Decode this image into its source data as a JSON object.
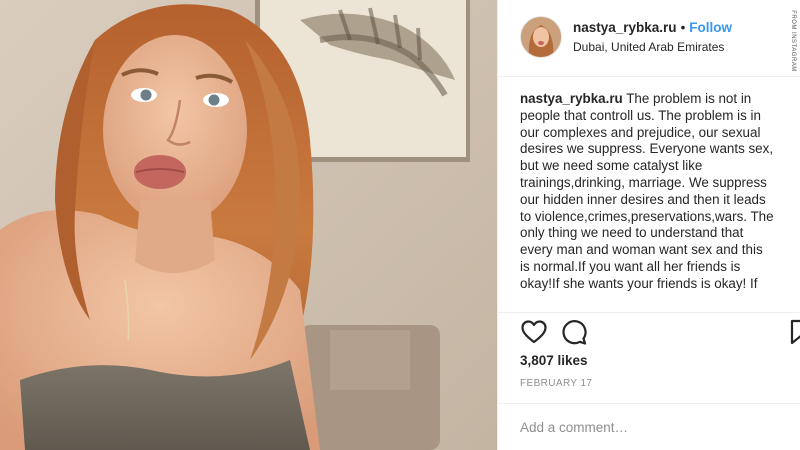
{
  "post": {
    "username": "nastya_rybka.ru",
    "separator": "•",
    "follow_label": "Follow",
    "location": "Dubai, United Arab Emirates",
    "credit": "FROM INSTAGRAM",
    "caption_user": "nastya_rybka.ru",
    "caption_text": "The problem is not in\npeople that controll us. The problem is in\nour complexes and prejudice, our sexual\ndesires we suppress. Everyone wants sex,\nbut we need some catalyst like\ntrainings,drinking, marriage. We suppress\nour hidden inner desires and then it leads\nto violence,crimes,preservations,wars. The\nonly thing we need to understand that\nevery man and woman want sex and this\nis normal.If you want all her friends is\nokay!If she wants your friends is okay! If",
    "likes": "3,807 likes",
    "date": "FEBRUARY 17",
    "comment_placeholder": "Add a comment…"
  },
  "icons": {
    "like": "heart-icon",
    "comment": "comment-bubble-icon",
    "save": "bookmark-icon"
  },
  "colors": {
    "link": "#3897f0",
    "text": "#262626",
    "muted": "#8e8e8e"
  }
}
